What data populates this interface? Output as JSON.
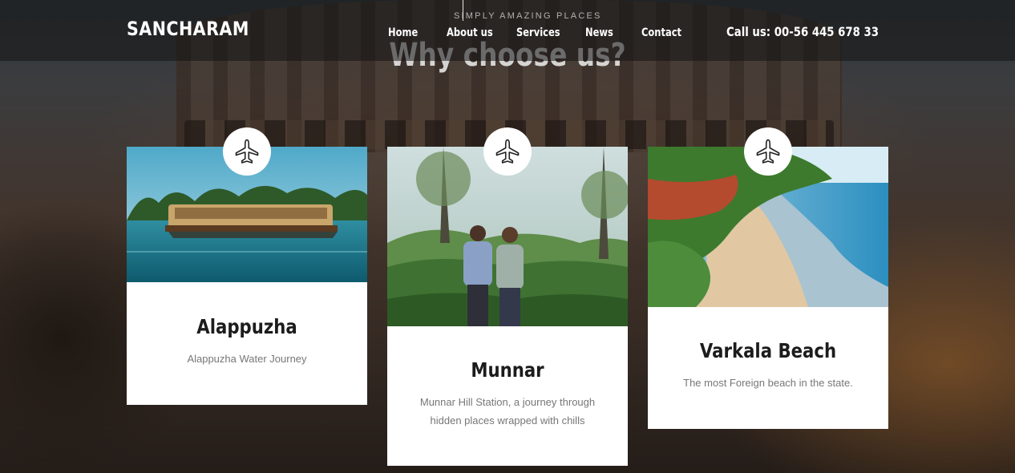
{
  "header": {
    "brand": "SANCHARAM",
    "nav": [
      "Home",
      "About us",
      "Services",
      "News",
      "Contact"
    ],
    "call": "Call us: 00-56 445 678 33"
  },
  "section": {
    "subtitle": "SIMPLY AMAZING PLACES",
    "title": "Why choose us?"
  },
  "cards": [
    {
      "title": "Alappuzha",
      "desc": "Alappuzha Water Journey",
      "icon": "airplane-icon"
    },
    {
      "title": "Munnar",
      "desc": "Munnar Hill Station, a journey through hidden places wrapped with chills",
      "icon": "airplane-icon"
    },
    {
      "title": "Varkala Beach",
      "desc": "The most Foreign beach in the state.",
      "icon": "airplane-icon"
    }
  ]
}
